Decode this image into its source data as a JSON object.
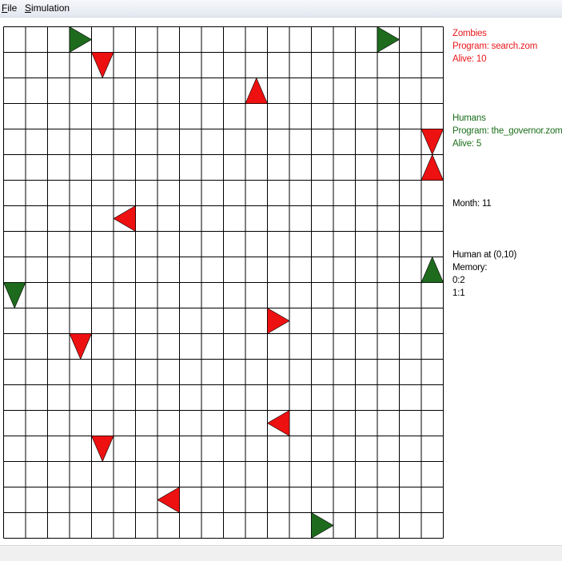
{
  "menu": {
    "file_accel": "F",
    "file_rest": "ile",
    "sim_accel": "S",
    "sim_rest": "imulation"
  },
  "colors": {
    "zombie": "#ee1111",
    "human": "#1e6b1e",
    "zombie_text": "#e8181c",
    "human_text": "#1c6e1c",
    "grid_line": "#000000"
  },
  "grid": {
    "columns": 20,
    "rows": 20,
    "agents": [
      {
        "kind": "human",
        "col": 3,
        "row": 0,
        "facing": "right"
      },
      {
        "kind": "human",
        "col": 17,
        "row": 0,
        "facing": "right"
      },
      {
        "kind": "zombie",
        "col": 4,
        "row": 1,
        "facing": "down"
      },
      {
        "kind": "zombie",
        "col": 11,
        "row": 2,
        "facing": "up"
      },
      {
        "kind": "zombie",
        "col": 19,
        "row": 4,
        "facing": "down"
      },
      {
        "kind": "zombie",
        "col": 19,
        "row": 5,
        "facing": "up"
      },
      {
        "kind": "zombie",
        "col": 5,
        "row": 7,
        "facing": "left"
      },
      {
        "kind": "human",
        "col": 19,
        "row": 9,
        "facing": "up"
      },
      {
        "kind": "human",
        "col": 0,
        "row": 10,
        "facing": "down"
      },
      {
        "kind": "zombie",
        "col": 12,
        "row": 11,
        "facing": "right"
      },
      {
        "kind": "zombie",
        "col": 3,
        "row": 12,
        "facing": "down"
      },
      {
        "kind": "zombie",
        "col": 12,
        "row": 15,
        "facing": "left"
      },
      {
        "kind": "zombie",
        "col": 4,
        "row": 16,
        "facing": "down"
      },
      {
        "kind": "zombie",
        "col": 7,
        "row": 18,
        "facing": "left"
      },
      {
        "kind": "human",
        "col": 14,
        "row": 19,
        "facing": "right"
      }
    ]
  },
  "zombies": {
    "title": "Zombies",
    "program": "Program: search.zom",
    "alive": "Alive: 10"
  },
  "humans": {
    "title": "Humans",
    "program": "Program: the_governor.zom",
    "alive": "Alive: 5"
  },
  "month": "Month: 11",
  "inspector": {
    "title": "Human at (0,10)",
    "memory_label": "Memory:",
    "entries": [
      "0:2",
      "1:1"
    ]
  }
}
